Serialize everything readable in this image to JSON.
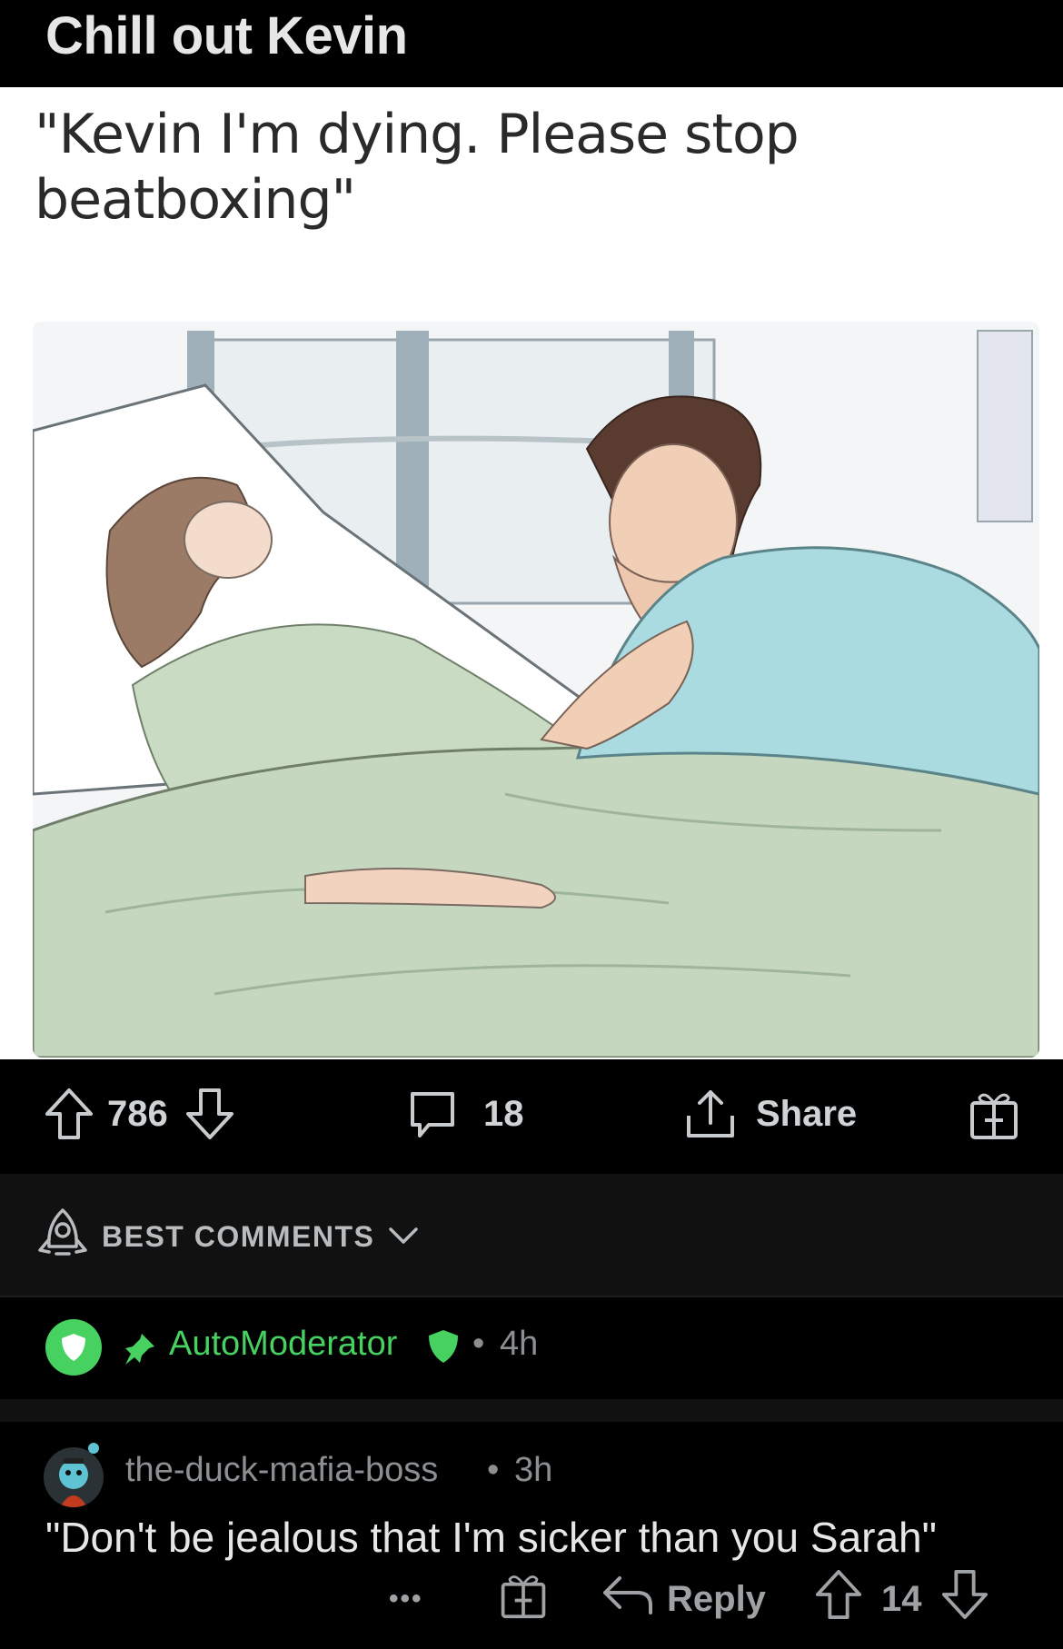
{
  "post": {
    "title": "Chill out Kevin",
    "meme_caption": "\"Kevin I'm dying. Please stop beatboxing\""
  },
  "actions": {
    "upvotes": "786",
    "comments": "18",
    "share_label": "Share"
  },
  "comments_section": {
    "sort_label": "BEST COMMENTS"
  },
  "comments": [
    {
      "author": "AutoModerator",
      "separator": "•",
      "age": "4h",
      "author_color": "#46d160"
    },
    {
      "author": "the-duck-mafia-boss",
      "separator": "•",
      "age": "3h",
      "body": "\"Don't be jealous that I'm sicker than you Sarah\"",
      "more_label": "•••",
      "reply_label": "Reply",
      "score": "14"
    }
  ],
  "colors": {
    "background": "#000000",
    "panel": "#111112",
    "mod_green": "#46d160",
    "text_muted": "#8b8f92"
  },
  "icons": [
    "upvote-icon",
    "downvote-icon",
    "comment-icon",
    "share-icon",
    "award-icon",
    "rocket-icon",
    "chevron-down-icon",
    "shield-icon",
    "pin-icon",
    "more-icon",
    "reply-icon"
  ]
}
